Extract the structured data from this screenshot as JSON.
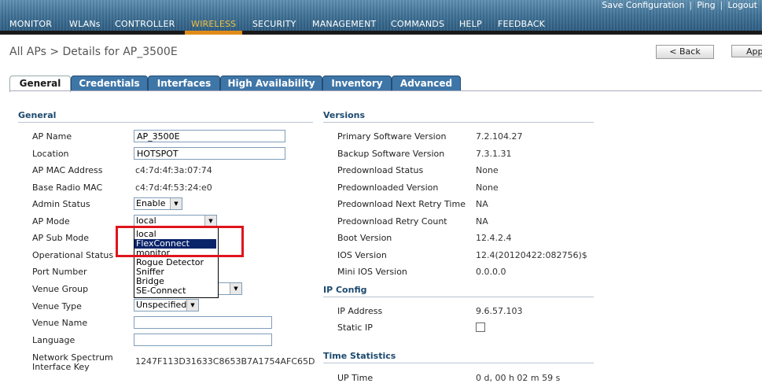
{
  "toplinks": [
    "Save Configuration",
    "Ping",
    "Logout"
  ],
  "nav": {
    "items": [
      "MONITOR",
      "WLANs",
      "CONTROLLER",
      "WIRELESS",
      "SECURITY",
      "MANAGEMENT",
      "COMMANDS",
      "HELP",
      "FEEDBACK"
    ],
    "active": "WIRELESS"
  },
  "page": {
    "title": "All APs > Details for AP_3500E",
    "back_label": "< Back",
    "apply_label": "Apply"
  },
  "tabs": [
    "General",
    "Credentials",
    "Interfaces",
    "High Availability",
    "Inventory",
    "Advanced"
  ],
  "general": {
    "heading": "General",
    "ap_name_label": "AP Name",
    "ap_name_value": "AP_3500E",
    "location_label": "Location",
    "location_value": "HOTSPOT",
    "mac_label": "AP MAC Address",
    "mac_value": "c4:7d:4f:3a:07:74",
    "base_mac_label": "Base Radio MAC",
    "base_mac_value": "c4:7d:4f:53:24:e0",
    "admin_label": "Admin Status",
    "admin_value": "Enable",
    "mode_label": "AP Mode",
    "mode_value": "local",
    "submode_label": "AP Sub Mode",
    "opstatus_label": "Operational Status",
    "port_label": "Port Number",
    "venue_group_label": "Venue Group",
    "venue_type_label": "Venue Type",
    "venue_type_value": "Unspecified",
    "venue_name_label": "Venue Name",
    "language_label": "Language",
    "nsi_label_1": "Network Spectrum",
    "nsi_label_2": "Interface Key",
    "nsi_value": "1247F113D31633C8653B7A1754AFC65D"
  },
  "mode_options": [
    "local",
    "FlexConnect",
    "monitor",
    "Rogue Detector",
    "Sniffer",
    "Bridge",
    "SE-Connect"
  ],
  "mode_highlighted": "FlexConnect",
  "versions": {
    "heading": "Versions",
    "rows": [
      {
        "label": "Primary Software Version",
        "value": "7.2.104.27"
      },
      {
        "label": "Backup Software Version",
        "value": "7.3.1.31"
      },
      {
        "label": "Predownload Status",
        "value": "None"
      },
      {
        "label": "Predownloaded Version",
        "value": "None"
      },
      {
        "label": "Predownload Next Retry Time",
        "value": "NA"
      },
      {
        "label": "Predownload Retry Count",
        "value": "NA"
      },
      {
        "label": "Boot Version",
        "value": "12.4.2.4"
      },
      {
        "label": "IOS Version",
        "value": "12.4(20120422:082756)$"
      },
      {
        "label": "Mini IOS Version",
        "value": "0.0.0.0"
      }
    ]
  },
  "ipconfig": {
    "heading": "IP Config",
    "ip_label": "IP Address",
    "ip_value": "9.6.57.103",
    "static_label": "Static IP"
  },
  "time": {
    "heading": "Time Statistics",
    "uptime_label": "UP Time",
    "uptime_value": "0 d, 00 h 02 m 59 s"
  }
}
